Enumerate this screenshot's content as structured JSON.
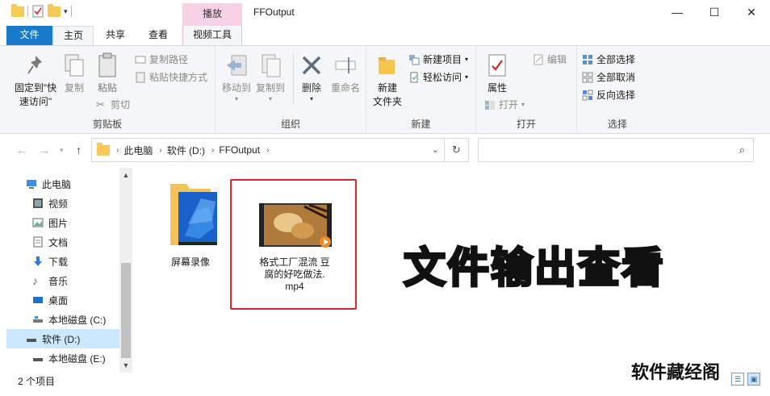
{
  "window": {
    "title": "FFOutput",
    "context_tab_group": "播放"
  },
  "tabs": {
    "file": "文件",
    "home": "主页",
    "share": "共享",
    "view": "查看",
    "video_tools": "视频工具"
  },
  "ribbon": {
    "clipboard": {
      "label": "剪贴板",
      "pin": "固定到\"快\n速访问\"",
      "copy": "复制",
      "paste": "粘贴",
      "copy_path": "复制路径",
      "paste_shortcut": "粘贴快捷方式",
      "cut": "剪切"
    },
    "organize": {
      "label": "组织",
      "move_to": "移动到",
      "copy_to": "复制到",
      "delete": "删除",
      "rename": "重命名"
    },
    "new": {
      "label": "新建",
      "new_folder": "新建\n文件夹",
      "new_item": "新建项目",
      "easy_access": "轻松访问"
    },
    "open": {
      "label": "打开",
      "properties": "属性",
      "open": "打开",
      "edit": "编辑"
    },
    "select": {
      "label": "选择",
      "select_all": "全部选择",
      "select_none": "全部取消",
      "invert": "反向选择"
    }
  },
  "address": {
    "crumbs": [
      "此电脑",
      "软件 (D:)",
      "FFOutput"
    ],
    "search_placeholder": ""
  },
  "sidebar": {
    "items": [
      {
        "label": "此电脑",
        "icon": "computer-icon"
      },
      {
        "label": "视频",
        "icon": "video-icon"
      },
      {
        "label": "图片",
        "icon": "picture-icon"
      },
      {
        "label": "文档",
        "icon": "document-icon"
      },
      {
        "label": "下载",
        "icon": "download-icon"
      },
      {
        "label": "音乐",
        "icon": "music-icon"
      },
      {
        "label": "桌面",
        "icon": "desktop-icon"
      },
      {
        "label": "本地磁盘 (C:)",
        "icon": "drive-icon"
      },
      {
        "label": "软件 (D:)",
        "icon": "drive-icon",
        "selected": true
      },
      {
        "label": "本地磁盘 (E:)",
        "icon": "drive-icon"
      }
    ]
  },
  "files": [
    {
      "name": "屏幕录像",
      "type": "folder"
    },
    {
      "name": "格式工厂混流 豆腐的好吃做法.mp4",
      "name_lines": [
        "格式工厂混流 豆",
        "腐的好吃做法.",
        "mp4"
      ],
      "type": "video"
    }
  ],
  "overlay_text": "文件输出查看",
  "watermark": "软件藏经阁",
  "status": {
    "count": "2 个项目"
  },
  "colors": {
    "accent": "#1979ca",
    "selection": "#cce8ff",
    "highlight_box": "#e0262b",
    "overlay": "#f6e51d"
  }
}
